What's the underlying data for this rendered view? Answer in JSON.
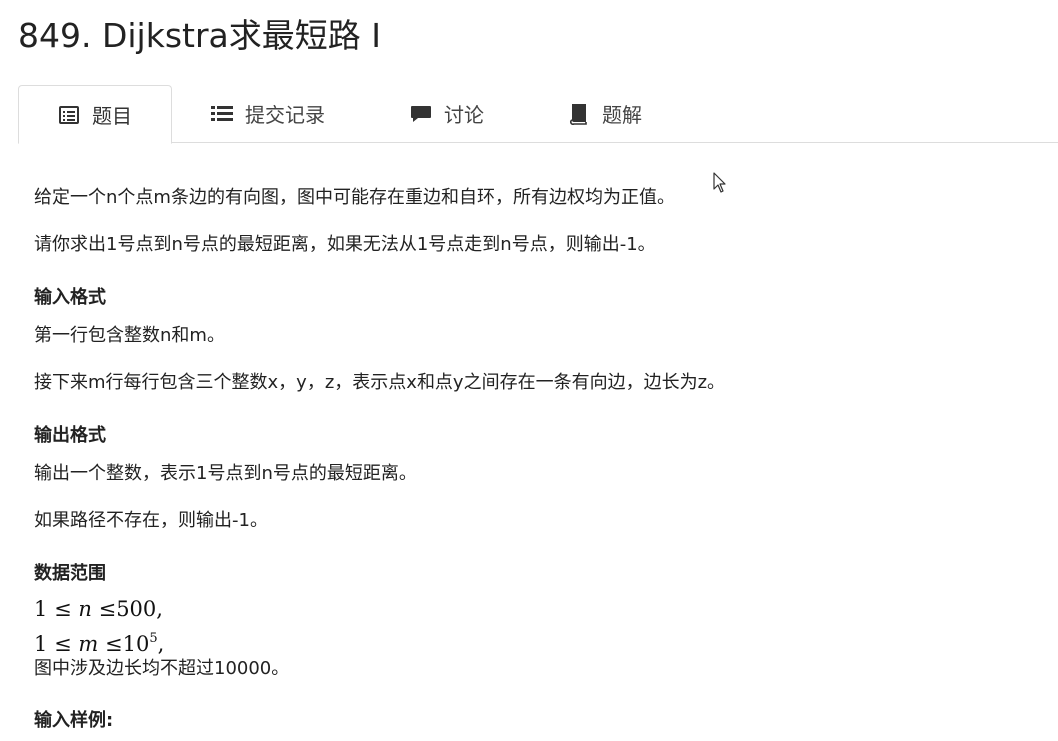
{
  "problem": {
    "title": "849. Dijkstra求最短路 I"
  },
  "tabs": [
    {
      "label": "题目",
      "icon": "list-alt-icon",
      "active": true
    },
    {
      "label": "提交记录",
      "icon": "list-icon",
      "active": false
    },
    {
      "label": "讨论",
      "icon": "comment-icon",
      "active": false
    },
    {
      "label": "题解",
      "icon": "book-icon",
      "active": false
    }
  ],
  "description": {
    "p1": "给定一个n个点m条边的有向图，图中可能存在重边和自环，所有边权均为正值。",
    "p2": "请你求出1号点到n号点的最短距离，如果无法从1号点走到n号点，则输出-1。"
  },
  "input_format": {
    "heading": "输入格式",
    "p1": "第一行包含整数n和m。",
    "p2": "接下来m行每行包含三个整数x，y，z，表示点x和点y之间存在一条有向边，边长为z。"
  },
  "output_format": {
    "heading": "输出格式",
    "p1": "输出一个整数，表示1号点到n号点的最短距离。",
    "p2": "如果路径不存在，则输出-1。"
  },
  "data_range": {
    "heading": "数据范围",
    "line1": {
      "lhs": "1",
      "rel1": "≤",
      "var": "n",
      "rel2": "≤",
      "rhs": "500",
      "tail": ","
    },
    "line2": {
      "lhs": "1",
      "rel1": "≤",
      "var": "m",
      "rel2": "≤",
      "base": "10",
      "exp": "5",
      "tail": ","
    },
    "note": "图中涉及边长均不超过10000。"
  },
  "sample_input": {
    "heading": "输入样例:"
  }
}
